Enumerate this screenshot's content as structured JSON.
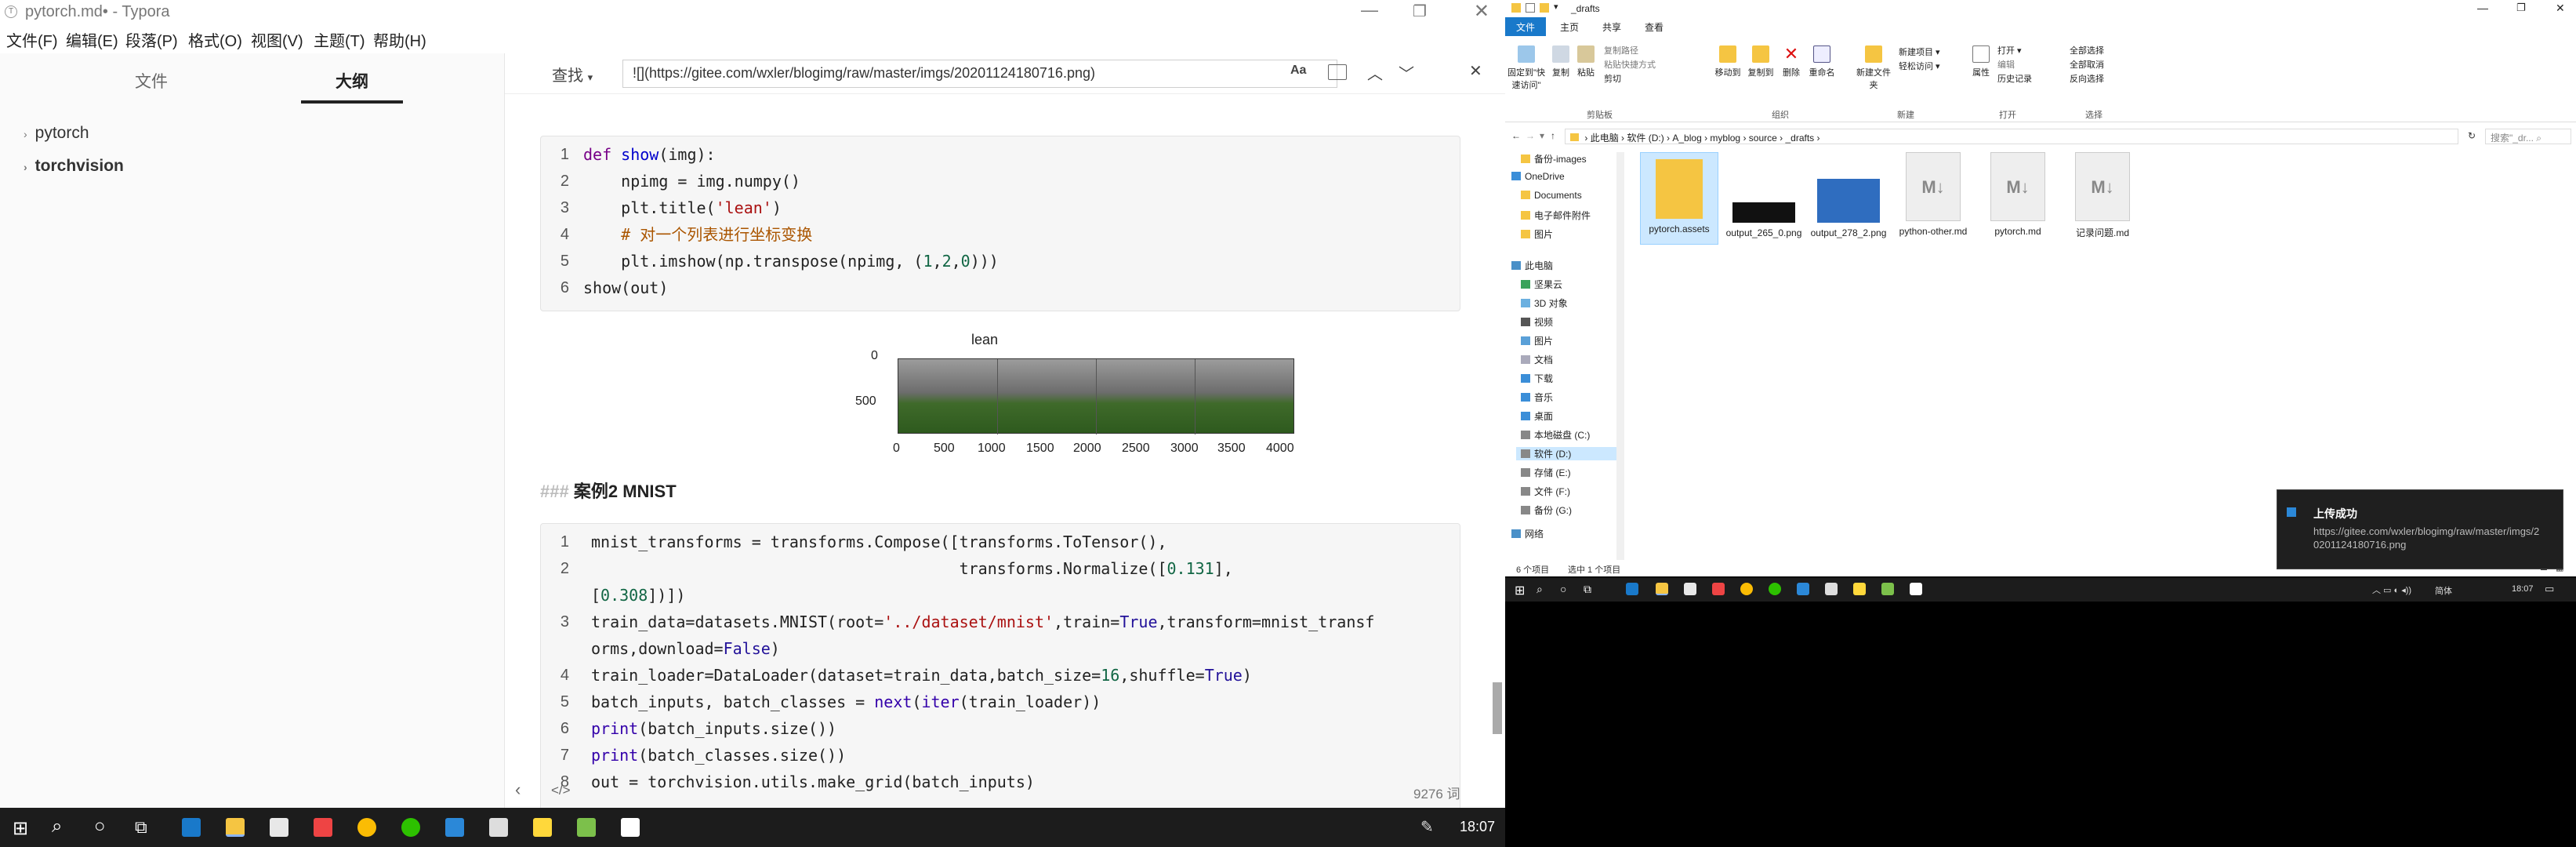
{
  "typora": {
    "title": "pytorch.md• - Typora",
    "menus": [
      "文件(F)",
      "编辑(E)",
      "段落(P)",
      "格式(O)",
      "视图(V)",
      "主题(T)",
      "帮助(H)"
    ],
    "sidebar_tabs": [
      "文件",
      "大纲"
    ],
    "outline": [
      "pytorch",
      "torchvision"
    ],
    "find_label": "查找",
    "find_value": "![](https://gitee.com/wxler/blogimg/raw/master/imgs/20201124180716.png)",
    "find_case_label": "Aa",
    "code1_lines": [
      "1",
      "2",
      "3",
      "4",
      "5",
      "6"
    ],
    "figure": {
      "title": "lean",
      "y_ticks": [
        "0",
        "500"
      ],
      "x_ticks": [
        "0",
        "500",
        "1000",
        "1500",
        "2000",
        "2500",
        "3000",
        "3500",
        "4000"
      ]
    },
    "heading_prefix": "###",
    "heading_text": "案例2 MNIST",
    "code2_lines": [
      "1",
      "2",
      "",
      "3",
      "",
      "4",
      "5",
      "6",
      "7",
      "8"
    ],
    "word_count": "9276 词",
    "src_toggle": "</>"
  },
  "explorer": {
    "title": "_drafts",
    "ribbon_tabs": [
      "文件",
      "主页",
      "共享",
      "查看"
    ],
    "ribbon_buttons": [
      "固定到\"快速访问\"",
      "复制",
      "粘贴",
      "复制路径",
      "粘贴快捷方式",
      "剪切",
      "移动到",
      "复制到",
      "删除",
      "重命名",
      "新建文件夹",
      "新建项目",
      "轻松访问",
      "属性",
      "打开",
      "编辑",
      "历史记录",
      "全部选择",
      "全部取消",
      "反向选择"
    ],
    "ribbon_groups": [
      "剪贴板",
      "组织",
      "新建",
      "打开",
      "选择"
    ],
    "address": [
      "此电脑",
      "软件 (D:)",
      "A_blog",
      "myblog",
      "source",
      "_drafts"
    ],
    "search_placeholder": "搜索\"_dr...",
    "nav": [
      "备份-images",
      "OneDrive",
      "Documents",
      "电子邮件附件",
      "图片",
      "此电脑",
      "坚果云",
      "3D 对象",
      "视频",
      "图片",
      "文档",
      "下载",
      "音乐",
      "桌面",
      "本地磁盘 (C:)",
      "软件 (D:)",
      "存储 (E:)",
      "文件 (F:)",
      "备份 (G:)",
      "网络"
    ],
    "files": [
      "pytorch.assets",
      "output_265_0.png",
      "output_278_2.png",
      "python-other.md",
      "pytorch.md",
      "记录问题.md"
    ],
    "status_count": "6 个项目",
    "status_selected": "选中 1 个项目"
  },
  "notification": {
    "title": "上传成功",
    "body": "https://gitee.com/wxler/blogimg/raw/master/imgs/20201124180716.png"
  },
  "taskbar": {
    "time": "18:07",
    "tray_right_text": "简体",
    "tray_right_time": "18:07"
  }
}
